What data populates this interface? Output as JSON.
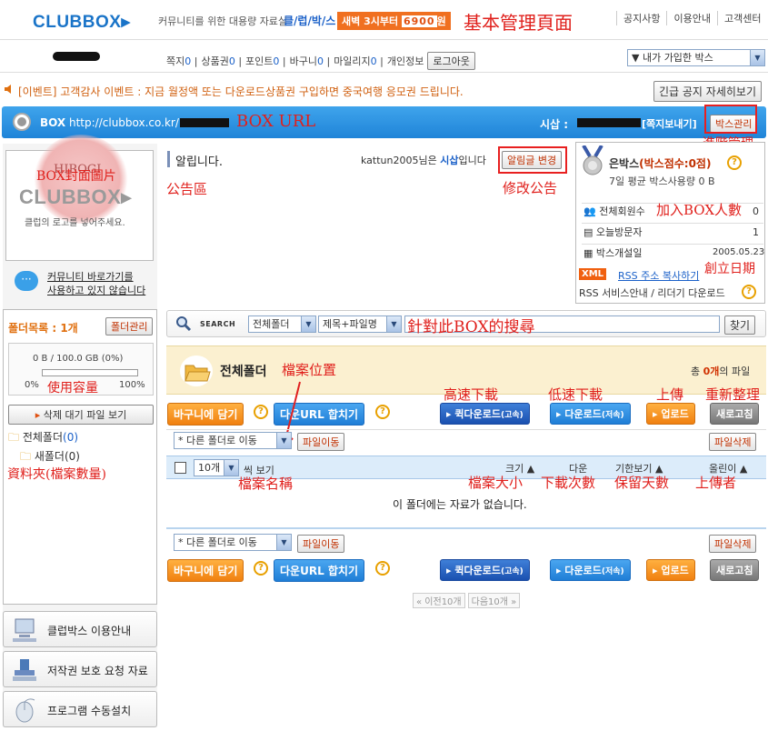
{
  "header": {
    "logo": "CLUBBOX",
    "tagline": "커뮤니티를 위한 대용량 자료실",
    "brand": "클/럽/박/스",
    "promo_prefix": "새벽 3시부터",
    "promo_price": "6900",
    "promo_unit": "원",
    "links": [
      "공지사항",
      "이용안내",
      "고객센터"
    ],
    "annotation": "基本管理頁面"
  },
  "navbar": {
    "items": [
      {
        "label": "쪽지",
        "count": "0"
      },
      {
        "label": "상품권",
        "count": "0"
      },
      {
        "label": "포인트",
        "count": "0"
      },
      {
        "label": "바구니",
        "count": "0"
      },
      {
        "label": "마일리지",
        "count": "0"
      }
    ],
    "profile": "개인정보",
    "logout": "로그아웃",
    "box_select": "▼ 내가 가입한 박스"
  },
  "notice": {
    "text": "[이벤트] 고객감사 이벤트 : 지금 월정액 또는 다운로드상품권 구입하면 중국여행 응모권 드립니다.",
    "button": "긴급 공지 자세히보기"
  },
  "box_header": {
    "label": "BOX",
    "url": "http://clubbox.co.kr/",
    "url_annotation": "BOX URL",
    "owner_label": "시삽 :",
    "message_link": "[쪽지보내기]",
    "manage_button": "박스관리",
    "manage_annotation": "進階管理"
  },
  "cover": {
    "logo": "CLUBBOX",
    "caption": "클럽의 로고를 넣어주세요.",
    "annotation": "BOX封面圖片",
    "stamp": "HIROGI",
    "shortcut_line1": "커뮤니티 바로가기를",
    "shortcut_line2": "사용하고 있지 않습니다"
  },
  "announcement": {
    "title": "알립니다.",
    "user": "kattun2005님은",
    "role": "시삽",
    "suffix": "입니다",
    "edit_button": "알림글 변경",
    "area_annotation": "公告區",
    "edit_annotation": "修改公告"
  },
  "stats": {
    "box_name": "은박스",
    "score": "(박스점수:0점)",
    "avg_usage": "7일 평균 박스사용량 0 B",
    "rows": [
      {
        "label": "전체회원수",
        "value": "0",
        "annotation": "加入BOX人數"
      },
      {
        "label": "오늘방문자",
        "value": "1",
        "annotation": ""
      },
      {
        "label": "박스개설일",
        "value": "2005.05.23",
        "annotation": "創立日期"
      }
    ],
    "xml_badge": "XML",
    "rss_link": "RSS 주소 복사하기",
    "rss_guide": "RSS 서비스안내 / 리더기 다운로드"
  },
  "folders": {
    "title": "폴더목록 : 1개",
    "manage_button": "폴더관리",
    "usage_text": "0 B / 100.0 GB (0%)",
    "usage_fraction": 0,
    "min_label": "0%",
    "max_label": "100%",
    "usage_annotation": "使用容量",
    "delete_waiting": "삭제 대기 파일 보기",
    "tree": [
      {
        "name": "전체폴더",
        "count": "(0)"
      },
      {
        "name": "새폴더",
        "count": "(0)"
      }
    ],
    "tree_annotation": "資料夾(檔案數量)"
  },
  "search": {
    "label": "SEARCH",
    "scope": "전체폴더",
    "field": "제목+파일명",
    "annotation": "針對此BOX的搜尋",
    "button": "찾기"
  },
  "folder_view": {
    "name": "전체폴더",
    "path_annotation": "檔案位置",
    "total_prefix": "총",
    "total_count": "0개",
    "total_suffix": "의 파일",
    "basket_button": "바구니에 담기",
    "merge_url_button": "다운URL 합치기",
    "quick_download": "퀵다운로드",
    "quick_sub": "(고속)",
    "download": "다운로드",
    "download_sub": "(저속)",
    "upload": "업로드",
    "refresh": "새로고침",
    "ann_fast": "高速下載",
    "ann_slow": "低速下載",
    "ann_upload": "上傳",
    "ann_refresh": "重新整理",
    "move_select": "* 다른 폴더로 이동",
    "move_button": "파일이동",
    "delete_button": "파일삭제",
    "per_page": "10개",
    "per_page_suffix": "씩 보기",
    "columns": {
      "size": "크기 ▲",
      "downloads": "다운",
      "expiry": "기한보기 ▲",
      "uploader": "올린이 ▲"
    },
    "col_annotations": {
      "name": "檔案名稱",
      "size": "檔案大小",
      "downloads": "下載次數",
      "expiry": "保留天數",
      "uploader": "上傳者"
    },
    "empty": "이 폴더에는 자료가 없습니다.",
    "prev": "이전10개",
    "next": "다음10개"
  },
  "side_links": [
    {
      "label": "클럽박스 이용안내"
    },
    {
      "label": "저작권 보호 요청 자료"
    },
    {
      "label": "프로그램 수동설치"
    }
  ]
}
